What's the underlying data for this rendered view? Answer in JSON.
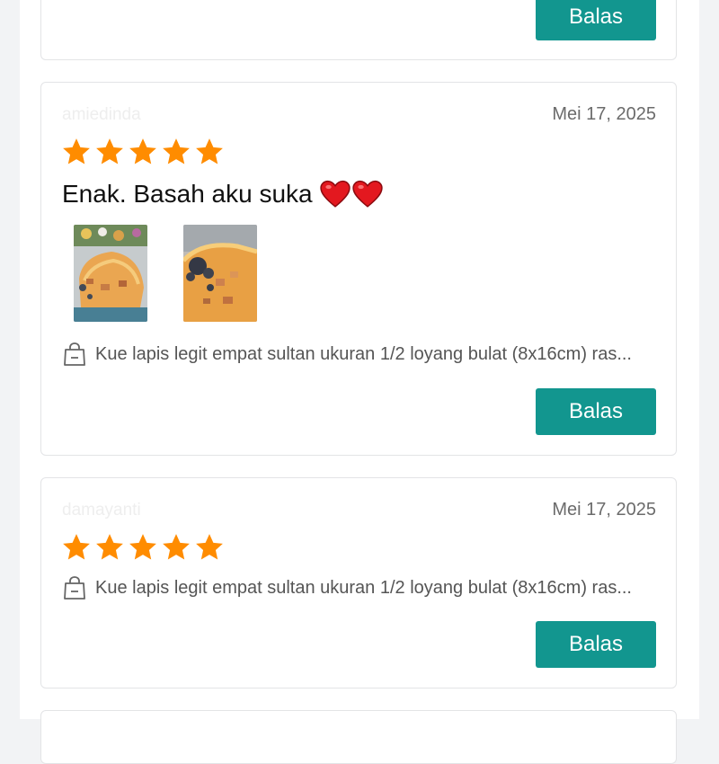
{
  "reply_label": "Balas",
  "reviews": [
    {
      "username": "amiedinda",
      "date": "Mei 17, 2025",
      "rating": 5,
      "text": "Enak. Basah aku suka",
      "emoji": "red-heart x2",
      "photos": [
        "photo-cake-in-box-with-flowers",
        "photo-cake-with-raisins"
      ],
      "product": "Kue lapis legit empat sultan ukuran 1/2 loyang bulat (8x16cm) ras..."
    },
    {
      "username": "damayanti",
      "date": "Mei 17, 2025",
      "rating": 5,
      "product": "Kue lapis legit empat sultan ukuran 1/2 loyang bulat (8x16cm) ras..."
    }
  ],
  "colors": {
    "accent": "#12968f",
    "star": "#ff8c00",
    "heart": "#e3181f",
    "date_text": "#6b6b6b"
  },
  "icons": {
    "star": "star-icon",
    "bag": "shopping-bag-icon",
    "heart": "heart-icon"
  }
}
